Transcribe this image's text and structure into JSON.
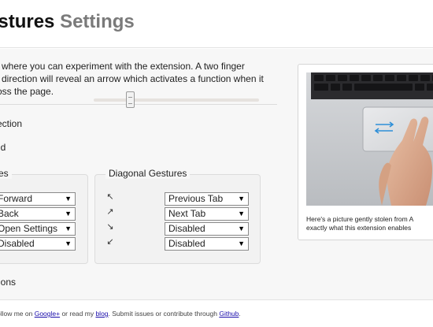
{
  "header": {
    "title_part1": "estures",
    "title_part2": "Settings"
  },
  "intro": {
    "line1": "ce where you can experiment with the extension. A two finger",
    "line2": "ny direction will reveal an arrow which activates a function when it",
    "line3": "cross the page."
  },
  "direction_label": "ection",
  "threshold_label": "ld",
  "slider": {
    "value_fraction": 0.22
  },
  "gestures": {
    "legend": "es",
    "items": [
      {
        "value": "Forward"
      },
      {
        "value": "Back"
      },
      {
        "value": "Open Settings"
      },
      {
        "value": "Disabled"
      }
    ]
  },
  "diagonal": {
    "legend": "Diagonal Gestures",
    "items": [
      {
        "icon": "arrow-up-left-icon",
        "glyph": "↖",
        "value": "Previous Tab"
      },
      {
        "icon": "arrow-up-right-icon",
        "glyph": "↗",
        "value": "Next Tab"
      },
      {
        "icon": "arrow-down-right-icon",
        "glyph": "↘",
        "value": "Disabled"
      },
      {
        "icon": "arrow-down-left-icon",
        "glyph": "↙",
        "value": "Disabled"
      }
    ]
  },
  "options_label": "ions",
  "card": {
    "caption_line1": "Here's a picture gently stolen from A",
    "caption_line2": "exactly what this extension enables"
  },
  "footer": {
    "t1": "ollow me on ",
    "google": "Google+",
    "t2": " or read my ",
    "blog": "blog",
    "t3": ". Submit issues or contribute through ",
    "github": "Github",
    "t4": "."
  },
  "select_arrow": "▼"
}
